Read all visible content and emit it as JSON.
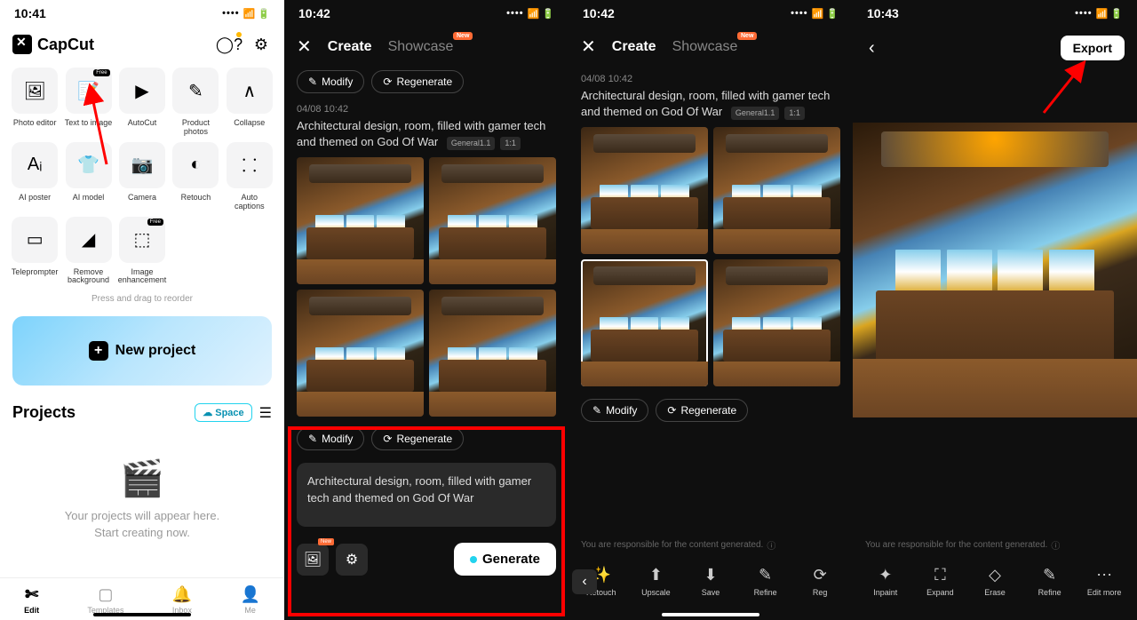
{
  "screen1": {
    "time": "10:41",
    "logo": "CapCut",
    "tools": [
      {
        "icon": "🖼",
        "label": "Photo editor"
      },
      {
        "icon": "📝",
        "label": "Text to image",
        "badge": "Free"
      },
      {
        "icon": "▶",
        "label": "AutoCut"
      },
      {
        "icon": "✎",
        "label": "Product photos"
      },
      {
        "icon": "∧",
        "label": "Collapse"
      },
      {
        "icon": "Aᵢ",
        "label": "AI poster"
      },
      {
        "icon": "👕",
        "label": "AI model"
      },
      {
        "icon": "📷",
        "label": "Camera"
      },
      {
        "icon": "◐",
        "label": "Retouch"
      },
      {
        "icon": "⸬",
        "label": "Auto captions"
      },
      {
        "icon": "▭",
        "label": "Teleprompter"
      },
      {
        "icon": "◢",
        "label": "Remove background"
      },
      {
        "icon": "⬚",
        "label": "Image enhancement",
        "badge": "Free"
      }
    ],
    "reorder": "Press and drag to reorder",
    "new_project": "New project",
    "projects_title": "Projects",
    "space": "Space",
    "empty_line1": "Your projects will appear here.",
    "empty_line2": "Start creating now.",
    "nav": [
      {
        "icon": "✄",
        "label": "Edit"
      },
      {
        "icon": "▢",
        "label": "Templates"
      },
      {
        "icon": "🔔",
        "label": "Inbox"
      },
      {
        "icon": "👤",
        "label": "Me"
      }
    ]
  },
  "screen2": {
    "time": "10:42",
    "tab_create": "Create",
    "tab_showcase": "Showcase",
    "new_badge": "New",
    "modify": "Modify",
    "regenerate": "Regenerate",
    "timestamp": "04/08 10:42",
    "prompt": "Architectural design, room, filled with gamer tech and themed on God Of War",
    "meta1": "General1.1",
    "meta2": "1:1",
    "input_text": "Architectural design, room, filled with gamer tech and themed on God Of War",
    "generate": "Generate"
  },
  "screen3": {
    "time": "10:42",
    "tab_create": "Create",
    "tab_showcase": "Showcase",
    "new_badge": "New",
    "timestamp": "04/08 10:42",
    "prompt": "Architectural design, room, filled with gamer tech and themed on God Of War",
    "meta1": "General1.1",
    "meta2": "1:1",
    "modify": "Modify",
    "regenerate": "Regenerate",
    "disclaimer": "You are responsible for the content generated.",
    "tools": [
      {
        "icon": "✨",
        "label": "Retouch"
      },
      {
        "icon": "⬆",
        "label": "Upscale"
      },
      {
        "icon": "⬇",
        "label": "Save"
      },
      {
        "icon": "✎",
        "label": "Refine"
      },
      {
        "icon": "⟳",
        "label": "Reg"
      }
    ]
  },
  "screen4": {
    "time": "10:43",
    "export": "Export",
    "disclaimer": "You are responsible for the content generated.",
    "tools": [
      {
        "icon": "✦",
        "label": "Inpaint"
      },
      {
        "icon": "⛶",
        "label": "Expand"
      },
      {
        "icon": "◇",
        "label": "Erase"
      },
      {
        "icon": "✎",
        "label": "Refine"
      },
      {
        "icon": "⋯",
        "label": "Edit more"
      }
    ]
  }
}
